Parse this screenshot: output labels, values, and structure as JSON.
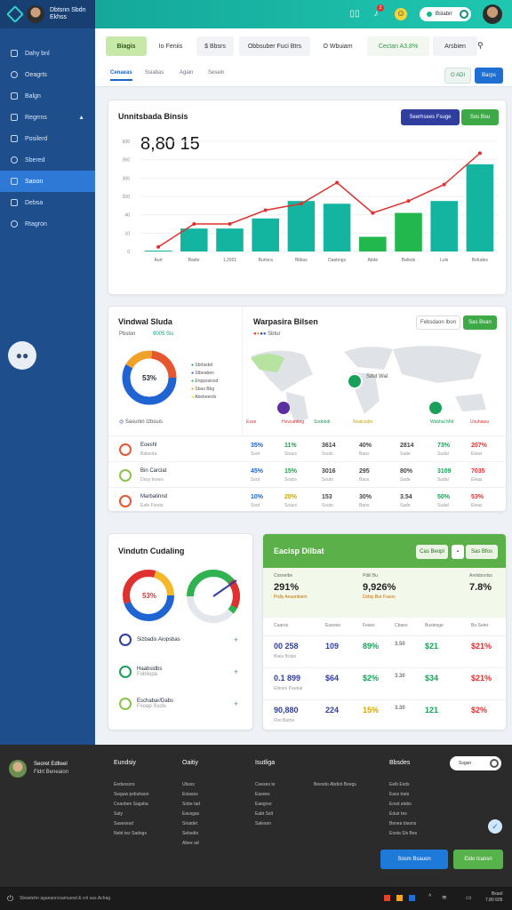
{
  "sidebar": {
    "user_line1": "Dbtsnn Sbdn",
    "user_line2": "Ekhss",
    "items": [
      {
        "label": "Dahy bnl"
      },
      {
        "label": "Oeagrts"
      },
      {
        "label": "Balgn"
      },
      {
        "label": "Regrrns"
      },
      {
        "label": "Posilerd"
      },
      {
        "label": "Sbered"
      },
      {
        "label": "Saoon"
      },
      {
        "label": "Debsa"
      },
      {
        "label": "Rtagron"
      }
    ]
  },
  "topbar": {
    "toggle_label": "Bslabrr",
    "notification_count": "2"
  },
  "tabs": [
    {
      "label": "Biagis"
    },
    {
      "label": "Io Feniis"
    },
    {
      "label": "$ Bbsrs"
    },
    {
      "label": "Obbsuber Fuci Btrs"
    },
    {
      "label": "O Wbuiam"
    },
    {
      "label": "Cectan A3.8%"
    },
    {
      "label": "Arsbien"
    }
  ],
  "subtabs": [
    {
      "label": "Cenaeas"
    },
    {
      "label": "Ssiabas"
    },
    {
      "label": "Again"
    },
    {
      "label": "Sesein"
    }
  ],
  "subtab_actions": {
    "outline": "O ADI",
    "primary": "Barps"
  },
  "main_chart": {
    "title": "Unnitsbada Binsis",
    "big_value": "8,80 15",
    "btn_primary": "Seerhsees Fsuge",
    "btn_secondary": "Sos Bsu"
  },
  "chart_data": {
    "type": "bar",
    "categories": [
      "Aurt",
      "Bador",
      "1,2001",
      "Burtsra",
      "Blibas",
      "Daebngs",
      "Abde",
      "Bafeds",
      "Luls",
      "Bsfudes"
    ],
    "y_ticks": [
      "600",
      "350",
      "300",
      "200",
      "40",
      "10",
      "0"
    ],
    "series": [
      {
        "values": [
          1,
          25,
          25,
          36,
          55,
          52,
          16,
          42,
          55,
          95
        ]
      },
      {
        "values": [
          5,
          30,
          30,
          45,
          52,
          75,
          42,
          55,
          73,
          107
        ]
      }
    ],
    "ylim": [
      0,
      120
    ],
    "colors": {
      "teal": "#13b5a0",
      "green": "#22b84e",
      "line": "#e03131"
    }
  },
  "widget_left": {
    "title": "Vindwal Sluda",
    "tag1": "Pbslon",
    "tag2": "9005 Sis",
    "donut_value": "53%",
    "legend": [
      "Sbrlasbd",
      "Stbeaben",
      "Enppssinsd",
      "Sbas Bbg",
      "Abebeerds"
    ],
    "footer_label": "Sasunin Izbsuis"
  },
  "widget_map": {
    "title": "Warpasira Bilsen",
    "btn_outline": "Febsdaon Ibon",
    "btn_green": "Sas Bvan",
    "legend": "Sbtur",
    "map_labels": [
      "Esee",
      "Hevcanting",
      "Sodebdi",
      "Noalcedin",
      "Wabhal Mtit",
      "Usuhawa"
    ],
    "pin_label": "Sdut Wal"
  },
  "table": {
    "rows": [
      {
        "name": "Eoeshl",
        "sub": "Babsota",
        "vals": [
          "35%",
          "11%",
          "3614",
          "40%",
          "2814",
          "73%",
          "207%"
        ]
      },
      {
        "name": "Bin Carclat",
        "sub": "Dssy bsoes",
        "vals": [
          "45%",
          "15%",
          "3016",
          "295",
          "80%",
          "3109",
          "7035"
        ]
      },
      {
        "name": "Marbatinnd",
        "sub": "Eafe Fsodu",
        "vals": [
          "10%",
          "20%",
          "153",
          "30%",
          "3.54",
          "50%",
          "53%"
        ]
      }
    ],
    "row_subs": [
      "Ssot",
      "Soacs",
      "Ssuto",
      "Baos",
      "Sade",
      "Sudal",
      "Eleaz"
    ]
  },
  "widget_ops": {
    "title": "Vindutn Cudaling",
    "donut_value": "53%",
    "items": [
      {
        "label": "Sizbadis Aiopsbas"
      },
      {
        "label": "Haabsidbs",
        "sub": "Fobliopa"
      },
      {
        "label": "Eschabar/Dabs",
        "sub": "Fsoap Ssols"
      }
    ]
  },
  "widget_stats": {
    "title": "Eacisp Dilbat",
    "btn1": "Cas Beopl",
    "btn2": "Sas Bfos",
    "kpis": [
      {
        "label": "Cosneibe",
        "value": "291%",
        "sub": "Prdiy Aeusnbiem"
      },
      {
        "label": "Pdiil Bu",
        "value": "9,926%",
        "sub": "Dzbiy Bor Fusos"
      },
      {
        "label": "Arelsbonlss",
        "value": "7.8%",
        "sub": ""
      }
    ],
    "headers": [
      "Cuaros",
      "Eueoso",
      "Foses",
      "Cbaes",
      "Bustesge",
      "Bu Seter"
    ],
    "rows": [
      {
        "vals": [
          "00 258",
          "109",
          "89%",
          "3.50",
          "$21",
          "$21%"
        ],
        "sub": "Biats Bolan"
      },
      {
        "vals": [
          "0.1 899",
          "$64",
          "$2%",
          "3.30",
          "$34",
          "$21%"
        ],
        "sub": "Eiboes Paubal"
      },
      {
        "vals": [
          "90,880",
          "224",
          "15%",
          "3.30",
          "121",
          "$2%"
        ],
        "sub": "Fbo Barbo"
      }
    ]
  },
  "footer": {
    "brand1": "Seoret Edlteel",
    "brand2": "Fldrt Beneaion",
    "cols": [
      {
        "title": "Eundsiy",
        "links": [
          "Eedsosors",
          "Swguw psbuhaon",
          "Ceaoben Sagsba",
          "Saty",
          "Sasesesd",
          "Nebt tez Sadogs"
        ]
      },
      {
        "title": "Oaitiy",
        "links": [
          "Ubsss",
          "Eoiasos",
          "Sobe tad",
          "Eavsgas",
          "Sriaidet",
          "Sebsdts",
          "Abee ad"
        ]
      },
      {
        "title": "Isutliga",
        "links": [
          "Ceeses te",
          "Easees",
          "Eaegrso",
          "Eabt Sslt",
          "Saleson"
        ]
      },
      {
        "title": "",
        "links": [
          "Beesdo Abdiot Beegs"
        ]
      },
      {
        "title": "Bbsdes",
        "links": [
          "Eelb Esds",
          "Eass trats",
          "Ensd atsbs",
          "Eduir tes",
          "Benea bisons",
          "Eosta Sls Bes"
        ]
      }
    ],
    "toggle": "Ssgan",
    "btn_blue": "Sosm Bsauon",
    "btn_green": "Eido Icansn",
    "bottom_text": "Sbswtehn agaeaorcoamuesd & cnl sas.Achag",
    "clock1": "Bsaol",
    "clock2": "7.80 605"
  }
}
